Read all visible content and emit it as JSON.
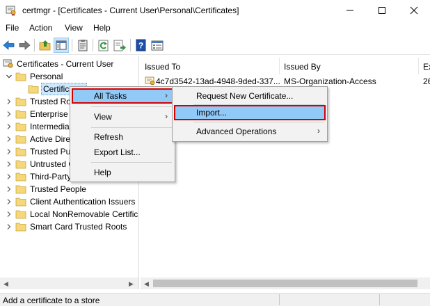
{
  "window": {
    "title": "certmgr - [Certificates - Current User\\Personal\\Certificates]",
    "minimize_icon": "minimize-icon",
    "maximize_icon": "maximize-icon",
    "close_icon": "close-icon"
  },
  "menubar": {
    "items": [
      "File",
      "Action",
      "View",
      "Help"
    ]
  },
  "toolbar": {
    "buttons": [
      "back-arrow-icon",
      "forward-arrow-icon",
      "up-folder-icon",
      "show-hide-tree-icon",
      "clipboard-icon",
      "refresh-icon",
      "export-list-icon",
      "help-icon",
      "properties-icon"
    ]
  },
  "tree": {
    "root": "Certificates - Current User",
    "items": [
      {
        "label": "Personal",
        "expanded": true
      },
      {
        "label": "Certificates",
        "selected": true
      },
      {
        "label": "Trusted Ro"
      },
      {
        "label": "Enterprise T"
      },
      {
        "label": "Intermedia"
      },
      {
        "label": "Active Dire"
      },
      {
        "label": "Trusted Pu"
      },
      {
        "label": "Untrusted C"
      },
      {
        "label": "Third-Party"
      },
      {
        "label": "Trusted People"
      },
      {
        "label": "Client Authentication Issuers"
      },
      {
        "label": "Local NonRemovable Certific"
      },
      {
        "label": "Smart Card Trusted Roots"
      }
    ]
  },
  "list": {
    "columns": [
      "Issued To",
      "Issued By",
      "Ex"
    ],
    "rows": [
      {
        "issued_to": "4c7d3542-13ad-4948-9ded-337...",
        "issued_by": "MS-Organization-Access",
        "expiry": "26"
      }
    ]
  },
  "context_menu": {
    "items": [
      {
        "label": "All Tasks",
        "submenu": true,
        "highlighted": true
      },
      {
        "label": "View",
        "submenu": true
      },
      {
        "label": "Refresh"
      },
      {
        "label": "Export List..."
      },
      {
        "label": "Help"
      }
    ]
  },
  "submenu": {
    "items": [
      {
        "label": "Request New Certificate..."
      },
      {
        "label": "Import...",
        "highlighted": true
      },
      {
        "label": "Advanced Operations",
        "submenu": true
      }
    ]
  },
  "statusbar": {
    "text": "Add a certificate to a store"
  },
  "colors": {
    "highlight": "#91c9f7",
    "annotation_red": "#d40000",
    "selection": "#cce8ff"
  }
}
